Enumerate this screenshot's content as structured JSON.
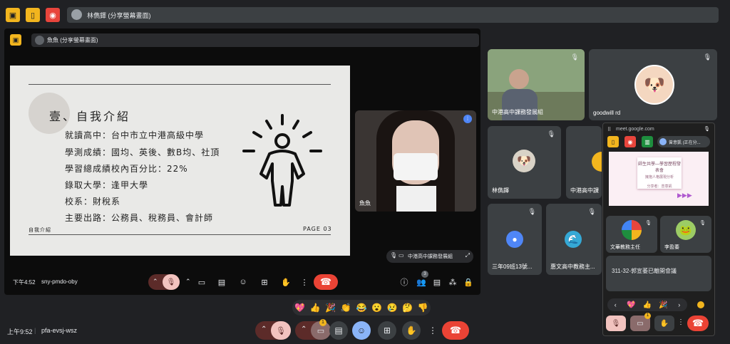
{
  "top_bar": {
    "presenter_label": "林儁鐸 (分享螢幕畫面)"
  },
  "stage": {
    "presenter_label": "魚魚 (分享螢幕畫面)",
    "slide": {
      "title": "壹、自我介紹",
      "lines": [
        "就讀高中：台中市立中港高級中學",
        "學測成績：國均、英後、數B均、社頂",
        "學習總成績校內百分比：22%",
        "錄取大學：逢甲大學",
        "校系：財稅系",
        "主要出路：公務員、稅務員、會計師"
      ],
      "footer_left": "自我介紹",
      "footer_right": "PAGE 03"
    },
    "self_tile_name": "魚魚",
    "self_view_label": "中港高中課務發展組",
    "time": "下午4:52",
    "meeting_code": "sny-pmdo-oby",
    "people_badge": "3"
  },
  "participants": [
    {
      "name": "中港高中課務發展組"
    },
    {
      "name": "goodwill rd"
    },
    {
      "name": "林儁鐸"
    },
    {
      "name": "中港高中課"
    },
    {
      "name": "三年09班13號..."
    },
    {
      "name": "惠文高中教務主..."
    }
  ],
  "pip": {
    "url": "meet.google.com",
    "user_chip": "曾意凱 (正在分...",
    "mini_slide_title": "師生共學—學習歷程發表會",
    "mini_slide_sub": "擁抱人格展現分析",
    "mini_slide_caption": "分享者：曾意凱",
    "tiles": [
      {
        "name": "文華教務主任"
      },
      {
        "name": "李盈蓁"
      }
    ],
    "notice": "311-32-郭宣萎已離開會議",
    "raise_badge": "1"
  },
  "bottom": {
    "time": "上午9:52",
    "meeting_code": "pfa-evsj-wsz",
    "camera_badge": "1"
  },
  "reactions": [
    "💖",
    "👍",
    "🎉",
    "👏",
    "😂",
    "😮",
    "😢",
    "🤔",
    "👎"
  ],
  "pip_reactions": [
    "💖",
    "👍",
    "🎉"
  ],
  "colors": {
    "accent_yellow": "#f2b51e",
    "hangup_red": "#ea4335",
    "tile_bg": "#3c4043",
    "bg": "#202124"
  }
}
